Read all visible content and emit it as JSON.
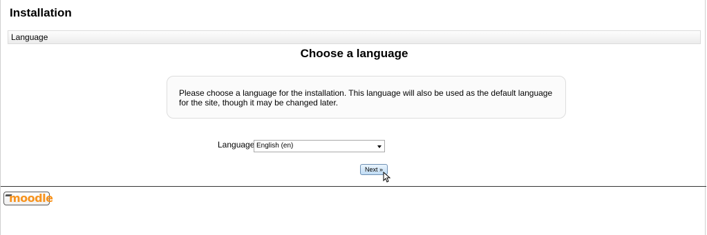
{
  "header": {
    "title": "Installation"
  },
  "breadcrumb": {
    "label": "Language"
  },
  "main": {
    "stage_title": "Choose a language",
    "info_text": "Please choose a language for the installation. This language will also be used as the default language for the site, though it may be changed later.",
    "language_label": "Language",
    "language_selected": "English (en)",
    "next_label": "Next »"
  },
  "footer": {
    "logo_text": "moodle"
  },
  "colors": {
    "logo_orange": "#f7931e",
    "button_top": "#e9f4fd",
    "button_bottom": "#bfdcf4"
  }
}
